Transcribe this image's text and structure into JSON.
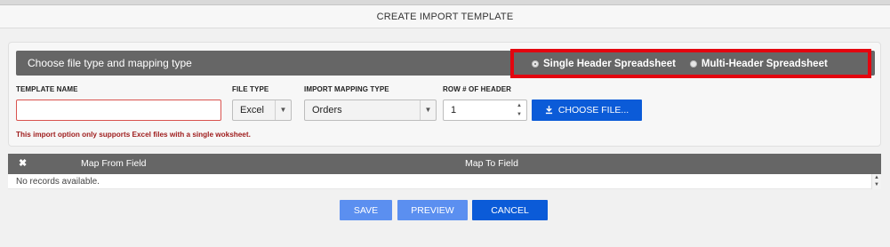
{
  "dialog": {
    "title": "CREATE IMPORT TEMPLATE"
  },
  "panel": {
    "header_title": "Choose file type and mapping type",
    "radios": [
      {
        "label": "Single Header Spreadsheet",
        "selected": true
      },
      {
        "label": "Multi-Header Spreadsheet",
        "selected": false
      }
    ],
    "highlight_color": "#e3050f"
  },
  "form": {
    "template_name": {
      "label": "TEMPLATE NAME",
      "value": ""
    },
    "file_type": {
      "label": "FILE TYPE",
      "value": "Excel"
    },
    "mapping_type": {
      "label": "IMPORT MAPPING TYPE",
      "value": "Orders"
    },
    "header_row": {
      "label": "ROW # OF HEADER",
      "value": "1"
    },
    "choose_file_label": "CHOOSE FILE...",
    "warning": "This import option only supports Excel files with a single woksheet."
  },
  "grid": {
    "remove_icon": "close-icon",
    "columns": [
      "Map From Field",
      "Map To Field"
    ],
    "empty_text": "No records available."
  },
  "actions": {
    "save": "SAVE",
    "preview": "PREVIEW",
    "cancel": "CANCEL"
  },
  "colors": {
    "primary": "#0b5bd8",
    "primary_light": "#5b8ff0",
    "header_bg": "#666666"
  }
}
